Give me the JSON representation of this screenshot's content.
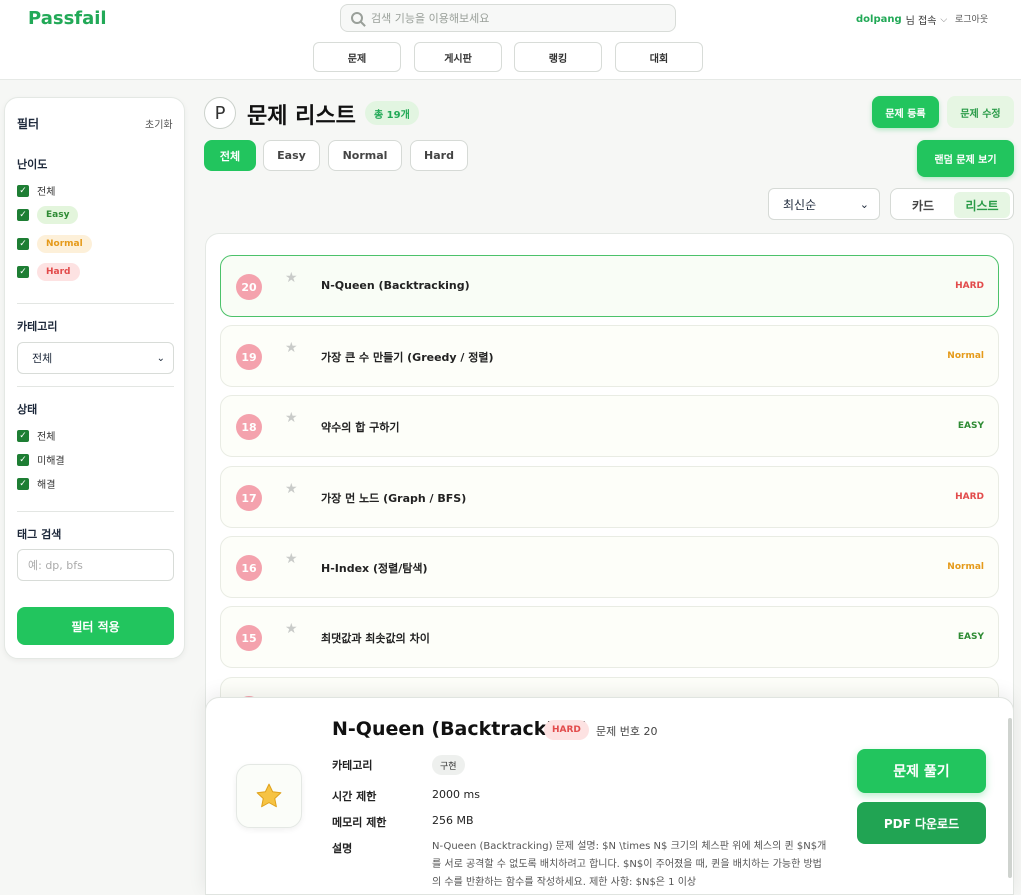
{
  "header": {
    "logo": "Passfail",
    "search_placeholder": "검색 기능을 이용해보세요",
    "username": "dolpang",
    "user_suffix": "님 접속",
    "logout": "로그아웃",
    "nav": [
      "문제",
      "게시판",
      "랭킹",
      "대회"
    ]
  },
  "sidebar": {
    "title": "필터",
    "reset": "초기화",
    "difficulty_heading": "난이도",
    "difficulty": [
      {
        "label": "전체",
        "checked": true
      },
      {
        "label": "Easy",
        "checked": true
      },
      {
        "label": "Normal",
        "checked": true
      },
      {
        "label": "Hard",
        "checked": true
      }
    ],
    "category_heading": "카테고리",
    "category_value": "전체",
    "status_heading": "상태",
    "status": [
      {
        "label": "전체",
        "checked": true
      },
      {
        "label": "미해결",
        "checked": true
      },
      {
        "label": "해결",
        "checked": true
      }
    ],
    "tag_heading": "태그 검색",
    "tag_placeholder": "예: dp, bfs",
    "apply": "필터 적용"
  },
  "main": {
    "icon_letter": "P",
    "title": "문제 리스트",
    "total": "총 19개",
    "register": "문제 등록",
    "edit": "문제 수정",
    "random": "랜덤 문제 보기",
    "tabs": [
      "전체",
      "Easy",
      "Normal",
      "Hard"
    ],
    "sort": "최신순",
    "view": [
      "카드",
      "리스트"
    ]
  },
  "problems": [
    {
      "num": "20",
      "title": "N-Queen (Backtracking)",
      "difficulty": "HARD"
    },
    {
      "num": "19",
      "title": "가장 큰 수 만들기 (Greedy / 정렬)",
      "difficulty": "Normal"
    },
    {
      "num": "18",
      "title": "약수의 합 구하기",
      "difficulty": "EASY"
    },
    {
      "num": "17",
      "title": "가장 먼 노드 (Graph / BFS)",
      "difficulty": "HARD"
    },
    {
      "num": "16",
      "title": "H-Index (정렬/탐색)",
      "difficulty": "Normal"
    },
    {
      "num": "15",
      "title": "최댓값과 최솟값의 차이",
      "difficulty": "EASY"
    }
  ],
  "detail": {
    "title": "N-Queen (Backtracking)",
    "badge": "HARD",
    "number": "문제 번호 20",
    "category_label": "카테고리",
    "category": "구현",
    "time_label": "시간 제한",
    "time": "2000 ms",
    "memory_label": "메모리 제한",
    "memory": "256 MB",
    "desc_label": "설명",
    "description": "N-Queen (Backtracking) 문제 설명: $N \\times N$ 크기의 체스판 위에 체스의 퀸 $N$개를 서로 공격할 수 없도록 배치하려고 합니다. $N$이 주어졌을 때, 퀸을 배치하는 가능한 방법의 수를 반환하는 함수를 작성하세요. 제한 사항: $N$은 1 이상",
    "solve": "문제 풀기",
    "pdf": "PDF 다운로드"
  },
  "colors": {
    "accent": "#22c55e",
    "hard": "#e24b4b",
    "normal": "#e59a1a",
    "easy": "#2e8b34"
  }
}
